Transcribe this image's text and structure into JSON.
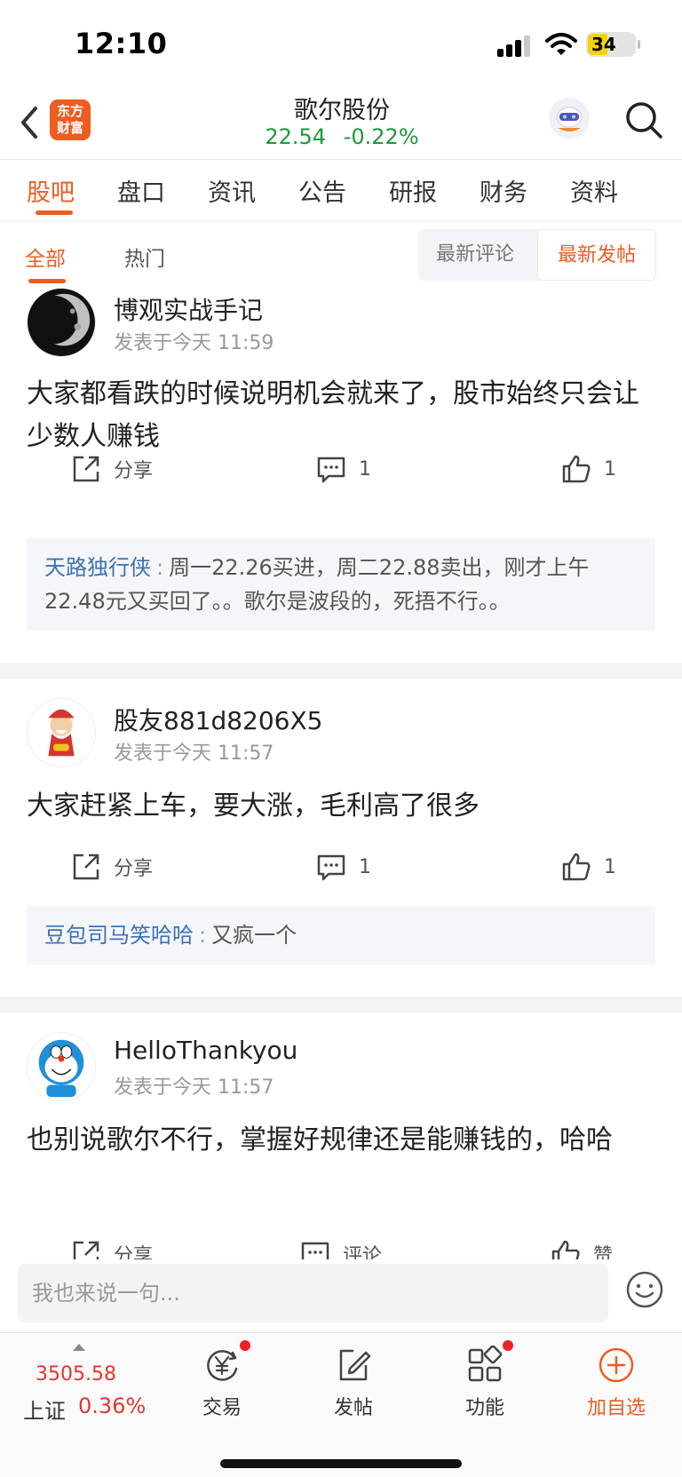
{
  "status_bar": {
    "time": "12:10",
    "battery": "34"
  },
  "header": {
    "logo_line1": "东方",
    "logo_line2": "财富",
    "title": "歌尔股份",
    "price": "22.54",
    "change": "-0.22%",
    "colors": {
      "down": "#1a9a3c",
      "accent": "#ee5c21"
    }
  },
  "tabs": [
    "股吧",
    "盘口",
    "资讯",
    "公告",
    "研报",
    "财务",
    "资料"
  ],
  "filter": {
    "tabs": [
      "全部",
      "热门"
    ],
    "sort": [
      "最新评论",
      "最新发帖"
    ]
  },
  "posts": [
    {
      "author": "博观实战手记",
      "time": "发表于今天 11:59",
      "body": "大家都看跌的时候说明机会就来了，股市始终只会让少数人赚钱",
      "share": "分享",
      "comments": "1",
      "likes": "1",
      "reply_user": "天路独行侠",
      "reply_text": "周一22.26买进，周二22.88卖出，刚才上午22.48元又买回了。。歌尔是波段的，死捂不行。。"
    },
    {
      "author": "股友881d8206X5",
      "time": "发表于今天 11:57",
      "body": "大家赶紧上车，要大涨，毛利高了很多",
      "share": "分享",
      "comments": "1",
      "likes": "1",
      "reply_user": "豆包司马笑哈哈",
      "reply_text": "又疯一个"
    },
    {
      "author": "HelloThankyou",
      "time": "发表于今天 11:57",
      "body": "也别说歌尔不行，掌握好规律还是能赚钱的，哈哈",
      "share": "分享",
      "comment_label": "评论",
      "like_label": "赞"
    }
  ],
  "composer": {
    "placeholder": "我也来说一句..."
  },
  "bottom_bar": {
    "index_value": "3505.58",
    "index_name": "上证",
    "index_pct": "0.36%",
    "items": [
      "交易",
      "发帖",
      "功能",
      "加自选"
    ]
  }
}
